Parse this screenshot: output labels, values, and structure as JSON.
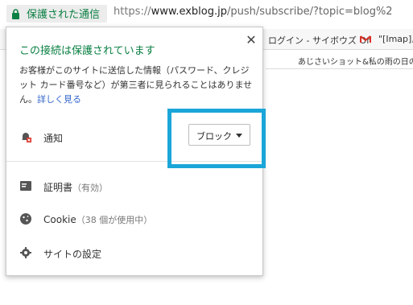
{
  "address_bar": {
    "secure_label": "保護された通信",
    "url_scheme": "https://",
    "url_host": "www.exblog.jp",
    "url_rest": "/push/subscribe/?topic=blog%2"
  },
  "bookmarks": {
    "item_cybozu": "ログイン - サイボウズ Of",
    "item_imap": "\"[Imap],"
  },
  "tab": {
    "title": "あじさいショット&私の雨の日の"
  },
  "popup": {
    "title": "この接続は保護されています",
    "description": "お客様がこのサイトに送信した情報（パスワード、クレジット カード番号など）が第三者に見られることはありません。",
    "details_link": "詳しく見る",
    "notification_label": "通知",
    "notification_select_value": "ブロック",
    "certificate_label": "証明書",
    "certificate_status": "（有効）",
    "cookie_label": "Cookie",
    "cookie_status": "（38 個が使用中）",
    "site_settings_label": "サイトの設定"
  },
  "colors": {
    "secure_green": "#0b8043",
    "link_blue": "#3366cc",
    "highlight_blue": "#1aa6d8",
    "gmail_red": "#d93025"
  },
  "icons": {
    "lock": "lock-icon",
    "close": "close-icon",
    "notification": "bell-blocked-icon",
    "certificate": "certificate-icon",
    "cookie": "cookie-icon",
    "settings": "gear-icon",
    "gmail": "gmail-icon",
    "dropdown": "chevron-down-icon"
  }
}
